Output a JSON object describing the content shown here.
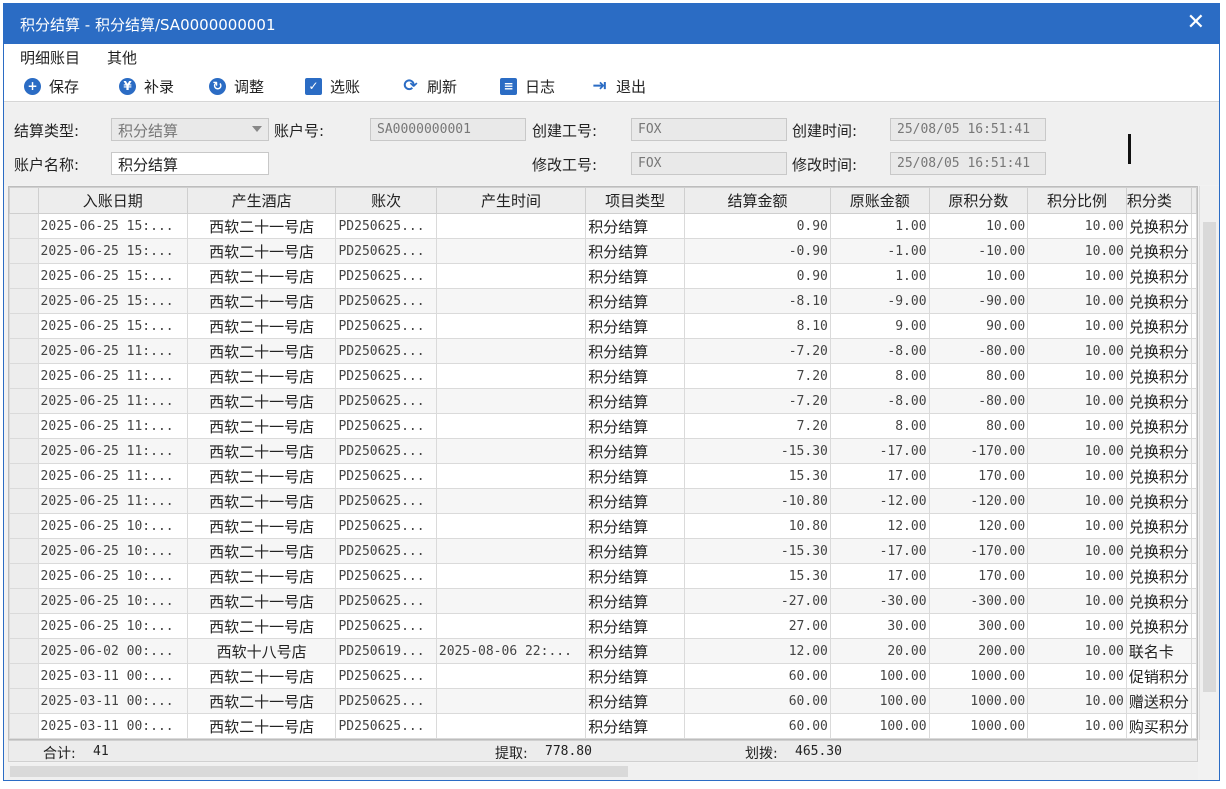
{
  "window": {
    "title": "积分结算 - 积分结算/SA0000000001",
    "close": "✕"
  },
  "menu": [
    "明细账目",
    "其他"
  ],
  "toolbar": [
    {
      "label": "保存",
      "icon": "plus-circle-icon",
      "glyph": "+"
    },
    {
      "label": "补录",
      "icon": "yen-circle-icon",
      "glyph": "¥"
    },
    {
      "label": "调整",
      "icon": "adjust-circle-icon",
      "glyph": "↻"
    },
    {
      "label": "选账",
      "icon": "select-check-icon",
      "glyph": "✓"
    },
    {
      "label": "刷新",
      "icon": "refresh-icon",
      "glyph": "⟳"
    },
    {
      "label": "日志",
      "icon": "log-icon",
      "glyph": "≡"
    },
    {
      "label": "退出",
      "icon": "exit-icon",
      "glyph": "⇥"
    }
  ],
  "form": {
    "settle_type_label": "结算类型:",
    "settle_type_value": "积分结算",
    "account_no_label": "账户号:",
    "account_no_value": "SA0000000001",
    "create_staff_label": "创建工号:",
    "create_staff_value": "FOX",
    "create_time_label": "创建时间:",
    "create_time_value": "25/08/05 16:51:41",
    "account_name_label": "账户名称:",
    "account_name_value": "积分结算",
    "modify_staff_label": "修改工号:",
    "modify_staff_value": "FOX",
    "modify_time_label": "修改时间:",
    "modify_time_value": "25/08/05 16:51:41"
  },
  "table": {
    "headers": [
      "入账日期",
      "产生酒店",
      "账次",
      "产生时间",
      "项目类型",
      "结算金额",
      "原账金额",
      "原积分数",
      "积分比例",
      "积分类"
    ],
    "rows": [
      [
        "2025-06-25 15:...",
        "西软二十一号店",
        "PD250625...",
        "",
        "积分结算",
        "0.90",
        "1.00",
        "10.00",
        "10.00",
        "兑换积分"
      ],
      [
        "2025-06-25 15:...",
        "西软二十一号店",
        "PD250625...",
        "",
        "积分结算",
        "-0.90",
        "-1.00",
        "-10.00",
        "10.00",
        "兑换积分"
      ],
      [
        "2025-06-25 15:...",
        "西软二十一号店",
        "PD250625...",
        "",
        "积分结算",
        "0.90",
        "1.00",
        "10.00",
        "10.00",
        "兑换积分"
      ],
      [
        "2025-06-25 15:...",
        "西软二十一号店",
        "PD250625...",
        "",
        "积分结算",
        "-8.10",
        "-9.00",
        "-90.00",
        "10.00",
        "兑换积分"
      ],
      [
        "2025-06-25 15:...",
        "西软二十一号店",
        "PD250625...",
        "",
        "积分结算",
        "8.10",
        "9.00",
        "90.00",
        "10.00",
        "兑换积分"
      ],
      [
        "2025-06-25 11:...",
        "西软二十一号店",
        "PD250625...",
        "",
        "积分结算",
        "-7.20",
        "-8.00",
        "-80.00",
        "10.00",
        "兑换积分"
      ],
      [
        "2025-06-25 11:...",
        "西软二十一号店",
        "PD250625...",
        "",
        "积分结算",
        "7.20",
        "8.00",
        "80.00",
        "10.00",
        "兑换积分"
      ],
      [
        "2025-06-25 11:...",
        "西软二十一号店",
        "PD250625...",
        "",
        "积分结算",
        "-7.20",
        "-8.00",
        "-80.00",
        "10.00",
        "兑换积分"
      ],
      [
        "2025-06-25 11:...",
        "西软二十一号店",
        "PD250625...",
        "",
        "积分结算",
        "7.20",
        "8.00",
        "80.00",
        "10.00",
        "兑换积分"
      ],
      [
        "2025-06-25 11:...",
        "西软二十一号店",
        "PD250625...",
        "",
        "积分结算",
        "-15.30",
        "-17.00",
        "-170.00",
        "10.00",
        "兑换积分"
      ],
      [
        "2025-06-25 11:...",
        "西软二十一号店",
        "PD250625...",
        "",
        "积分结算",
        "15.30",
        "17.00",
        "170.00",
        "10.00",
        "兑换积分"
      ],
      [
        "2025-06-25 11:...",
        "西软二十一号店",
        "PD250625...",
        "",
        "积分结算",
        "-10.80",
        "-12.00",
        "-120.00",
        "10.00",
        "兑换积分"
      ],
      [
        "2025-06-25 10:...",
        "西软二十一号店",
        "PD250625...",
        "",
        "积分结算",
        "10.80",
        "12.00",
        "120.00",
        "10.00",
        "兑换积分"
      ],
      [
        "2025-06-25 10:...",
        "西软二十一号店",
        "PD250625...",
        "",
        "积分结算",
        "-15.30",
        "-17.00",
        "-170.00",
        "10.00",
        "兑换积分"
      ],
      [
        "2025-06-25 10:...",
        "西软二十一号店",
        "PD250625...",
        "",
        "积分结算",
        "15.30",
        "17.00",
        "170.00",
        "10.00",
        "兑换积分"
      ],
      [
        "2025-06-25 10:...",
        "西软二十一号店",
        "PD250625...",
        "",
        "积分结算",
        "-27.00",
        "-30.00",
        "-300.00",
        "10.00",
        "兑换积分"
      ],
      [
        "2025-06-25 10:...",
        "西软二十一号店",
        "PD250625...",
        "",
        "积分结算",
        "27.00",
        "30.00",
        "300.00",
        "10.00",
        "兑换积分"
      ],
      [
        "2025-06-02 00:...",
        "西软十八号店",
        "PD250619...",
        "2025-08-06 22:...",
        "积分结算",
        "12.00",
        "20.00",
        "200.00",
        "10.00",
        "联名卡"
      ],
      [
        "2025-03-11 00:...",
        "西软二十一号店",
        "PD250625...",
        "",
        "积分结算",
        "60.00",
        "100.00",
        "1000.00",
        "10.00",
        "促销积分"
      ],
      [
        "2025-03-11 00:...",
        "西软二十一号店",
        "PD250625...",
        "",
        "积分结算",
        "60.00",
        "100.00",
        "1000.00",
        "10.00",
        "赠送积分"
      ],
      [
        "2025-03-11 00:...",
        "西软二十一号店",
        "PD250625...",
        "",
        "积分结算",
        "60.00",
        "100.00",
        "1000.00",
        "10.00",
        "购买积分"
      ]
    ]
  },
  "footer": {
    "total_label": "合计:",
    "total_value": "41",
    "extract_label": "提取:",
    "extract_value": "778.80",
    "transfer_label": "划拨:",
    "transfer_value": "465.30"
  },
  "colors": {
    "accent": "#2b6cc4"
  }
}
